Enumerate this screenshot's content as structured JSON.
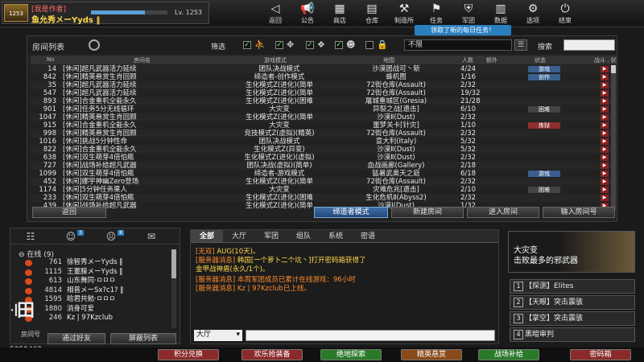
{
  "player": {
    "rank_badge": "1253",
    "guild": "[我是作者]",
    "name": "鱼允秀メーYyds ‖",
    "level": "Lv. 1253",
    "exp_percent": 70
  },
  "nav": [
    {
      "label": "返回",
      "icon": "arrow-back-icon",
      "glyph": "◁"
    },
    {
      "label": "公告",
      "icon": "megaphone-icon",
      "glyph": "📢"
    },
    {
      "label": "商店",
      "icon": "shop-icon",
      "glyph": "▦"
    },
    {
      "label": "仓库",
      "icon": "inventory-icon",
      "glyph": "▤"
    },
    {
      "label": "制造所",
      "icon": "factory-icon",
      "glyph": "⚒"
    },
    {
      "label": "任务",
      "icon": "mission-icon",
      "glyph": "⚑"
    },
    {
      "label": "军团",
      "icon": "clan-icon",
      "glyph": "⛨"
    },
    {
      "label": "数据",
      "icon": "stats-icon",
      "glyph": "▥"
    },
    {
      "label": "选项",
      "icon": "options-icon",
      "glyph": "⚙"
    },
    {
      "label": "结束",
      "icon": "power-icon",
      "glyph": "⏻"
    }
  ],
  "notice": "领取了新的每日任务！",
  "room_list": {
    "title": "房间列表",
    "filter_label": "筛选",
    "filter_select": "不限",
    "search_label": "搜索",
    "headers": {
      "no": "No",
      "name": "房间名",
      "mode": "游戏模式",
      "map": "地图",
      "count": "人数",
      "status": "状态",
      "tag": "额外",
      "extra": "战斗 . 状态"
    },
    "rows": [
      {
        "no": "14",
        "name": "[休闲]超凡武器活力延续",
        "mode": "团队决战模式",
        "map": "沙漠团战可丶斩",
        "count": "4/24",
        "act": "游戏",
        "style": "blue"
      },
      {
        "no": "842",
        "name": "[休闲]精英悬赏生肖回顾",
        "mode": "缔造者-创作模式",
        "map": "蜂机图",
        "count": "1/16",
        "act": "创作",
        "style": "blue"
      },
      {
        "no": "35",
        "name": "[休闲]超凡武器活力延续",
        "mode": "生化模式Z(进化)(简单",
        "map": "72街仓库(Assault)",
        "count": "2/32",
        "act": "",
        "style": ""
      },
      {
        "no": "547",
        "name": "[休闲]超凡武器活力延续",
        "mode": "生化模式Z(进化)(简单",
        "map": "72街仓库(Assault)",
        "count": "19/32",
        "act": "",
        "style": ""
      },
      {
        "no": "893",
        "name": "[休闲]合金重机全能永久",
        "mode": "生化模式Z(进化)(困难",
        "map": "屠城重城区(Gresia)",
        "count": "21/28",
        "act": "",
        "style": ""
      },
      {
        "no": "901",
        "name": "[休闲]任务5分无线循环",
        "mode": "大灾变",
        "map": "异裂之战[遗击]",
        "count": "6/10",
        "act": "困难",
        "style": "dark"
      },
      {
        "no": "1047",
        "name": "[休闲]精英悬赏生肖回顾",
        "mode": "生化模式Z(进化)(简单",
        "map": "沙漠Ⅱ(Dust)",
        "count": "2/32",
        "act": "",
        "style": ""
      },
      {
        "no": "915",
        "name": "[休闲]合金重机全能永久",
        "mode": "大灾变",
        "map": "噩梦关卡[针灾]",
        "count": "1/10",
        "act": "炼狱",
        "style": "red"
      },
      {
        "no": "998",
        "name": "[休闲]精英悬赏生肖回顾",
        "mode": "竞技模式Z(虚拟)(精英)",
        "map": "72街仓库(Assault)",
        "count": "2/32",
        "act": "",
        "style": ""
      },
      {
        "no": "1016",
        "name": "[休闲]挑战5分钟性命",
        "mode": "团队决战模式",
        "map": "意大利(Italy)",
        "count": "5/32",
        "act": "",
        "style": ""
      },
      {
        "no": "822",
        "name": "[休闲]合金重机全能永久",
        "mode": "生化模式Z(异变)",
        "map": "沙漠Ⅱ(Dust)",
        "count": "5/32",
        "act": "",
        "style": ""
      },
      {
        "no": "638",
        "name": "[休闲]双生萌芽4倍怕瓶",
        "mode": "生化模式Z(进化)(虚拟)",
        "map": "沙漠Ⅱ(Dust)",
        "count": "2/32",
        "act": "",
        "style": ""
      },
      {
        "no": "727",
        "name": "[休闲]战场补给超凡武器",
        "mode": "团队决战(虚拟)(简单)",
        "map": "血战画廊(Gallery)",
        "count": "2/18",
        "act": "",
        "style": ""
      },
      {
        "no": "1099",
        "name": "[休闲]双生萌芽4倍怕瓶",
        "mode": "缔造者-游戏模式",
        "map": "猛暑武奥天之庭",
        "count": "6/18",
        "act": "游戏",
        "style": "blue"
      },
      {
        "no": "452",
        "name": "[休闲]娜宇神幽Zero登场",
        "mode": "生化模式Z(进化)(简单",
        "map": "72街仓库(Assault)",
        "count": "2/32",
        "act": "",
        "style": ""
      },
      {
        "no": "1174",
        "name": "[休闲]5分钟任务果人",
        "mode": "大灾变",
        "map": "灾难危兆[遗击]",
        "count": "2/10",
        "act": "困难",
        "style": "dark"
      },
      {
        "no": "233",
        "name": "[休闲]双生萌芽4倍怕瓶",
        "mode": "生化模式Z(进化)(困难",
        "map": "生化危机Ⅱ(Abyss2)",
        "count": "2/32",
        "act": "",
        "style": ""
      },
      {
        "no": "439",
        "name": "[休闲]战场补给超凡武器",
        "mode": "生化模式Z(进化)(简单",
        "map": "沙漠Ⅰ(Dust)",
        "count": "1/32",
        "act": "",
        "style": ""
      }
    ],
    "buttons": {
      "back": "返回",
      "creator_mode": "缔造者模式",
      "new_room": "新建房间",
      "enter_room": "进入房间",
      "enter_room_no": "输入房间号"
    }
  },
  "friends": {
    "tab_badges": [
      "",
      "3",
      "8",
      ""
    ],
    "online_label": "在线 (9)",
    "list": [
      {
        "lv": "761",
        "name": "徐智秀メーYyds ‖"
      },
      {
        "lv": "1115",
        "name": "王董膜メーYyds ‖"
      },
      {
        "lv": "613",
        "name": "山东舞同·ㅁㅁㅁ"
      },
      {
        "lv": "4814",
        "name": "相普メーSx?c1? ‖"
      },
      {
        "lv": "1595",
        "name": "晗君共勉·ㅁㅁㅁ"
      },
      {
        "lv": "1880",
        "name": "消身可爱"
      },
      {
        "lv": "246",
        "name": "Kz | 97Kzclub"
      }
    ],
    "add_friend": "通过好友",
    "block_list": "屏蔽列表",
    "logo": "꜊田",
    "logo_sub": "房间号",
    "qq": "5359462",
    "help": "帮助"
  },
  "chat": {
    "tabs": [
      "全部",
      "大厅",
      "军团",
      "组队",
      "系统",
      "密语"
    ],
    "lines": [
      {
        "tag": "[无双]",
        "text": " AUG(10天)。"
      },
      {
        "tag": "[服务器消息]",
        "text": " 韩国[一个萝卜二个坑丶]打开密码箱获得了"
      },
      {
        "tag": "",
        "text": "金甲战神盾(永久/1个)。"
      },
      {
        "tag": "[服务器消息]",
        "text": " 本周军团成员已累计在线游戏：96小时"
      },
      {
        "tag": "[服务器消息]",
        "text": " Kz | 97Kzclub已上线。"
      }
    ],
    "channel": "大厅"
  },
  "mission": {
    "title": "大灾变",
    "sub": "击败最多的邪武器",
    "items": [
      {
        "num": "1",
        "text": "【探测】Elites"
      },
      {
        "num": "2",
        "text": "【天眼】突击震骇"
      },
      {
        "num": "3",
        "text": "【掌空】突击震骇"
      },
      {
        "num": "4",
        "text": "黑暗审判"
      }
    ]
  },
  "bottom_bar": [
    {
      "label": "积分兑换",
      "color": "#8a2a2a"
    },
    {
      "label": "欢乐抢装备",
      "color": "#8a2a2a"
    },
    {
      "label": "绝地探索",
      "color": "#2a7a2a"
    },
    {
      "label": "精英悬赏",
      "color": "#8a4a1a"
    },
    {
      "label": "战场补给",
      "color": "#2a7a2a"
    },
    {
      "label": "密码箱",
      "color": "#8a2a2a"
    }
  ]
}
